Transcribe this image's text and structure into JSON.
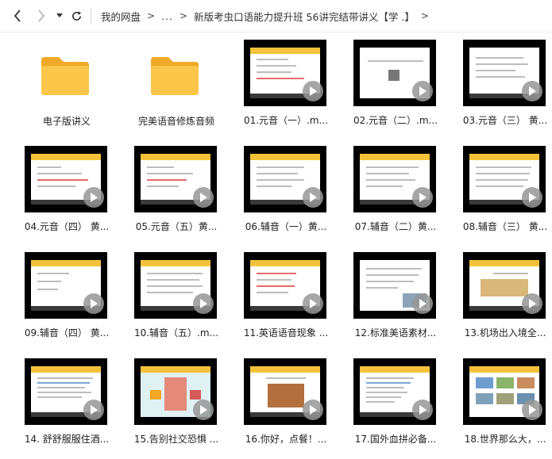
{
  "nav": {
    "back": "back-icon",
    "forward": "forward-icon",
    "dropdown": "caret-down-icon",
    "refresh": "refresh-icon"
  },
  "breadcrumb": {
    "root": "我的网盘",
    "ellipsis": "...",
    "current": "新版考虫口语能力提升班 56讲完结带讲义【学 .】"
  },
  "colors": {
    "folder": "#f6b93b",
    "thumb_bg": "#000000",
    "slide_band": "#f3c23a"
  },
  "items": [
    {
      "name": "电子版讲义",
      "type": "folder"
    },
    {
      "name": "完美语音修炼音频",
      "type": "folder"
    },
    {
      "name": "01.元音（一）.m...",
      "type": "video"
    },
    {
      "name": "02.元音（二）.m...",
      "type": "video"
    },
    {
      "name": "03.元音（三） 黄...",
      "type": "video"
    },
    {
      "name": "04.元音（四） 黄...",
      "type": "video"
    },
    {
      "name": "05.元音（五）黄...",
      "type": "video"
    },
    {
      "name": "06.辅音（一）黄...",
      "type": "video"
    },
    {
      "name": "07.辅音（二）黄...",
      "type": "video"
    },
    {
      "name": "08.辅音（三） 黄...",
      "type": "video"
    },
    {
      "name": "09.辅音（四） 黄...",
      "type": "video"
    },
    {
      "name": "10.辅音（五）.m...",
      "type": "video"
    },
    {
      "name": "11.英语语音现象 ...",
      "type": "video"
    },
    {
      "name": "12.标准美语素材...",
      "type": "video"
    },
    {
      "name": "13.机场出入境全...",
      "type": "video"
    },
    {
      "name": "14. 舒舒服服住酒...",
      "type": "video"
    },
    {
      "name": "15.告别社交恐惧 ...",
      "type": "video"
    },
    {
      "name": "16.你好，点餐！...",
      "type": "video"
    },
    {
      "name": "17.国外血拼必备...",
      "type": "video"
    },
    {
      "name": "18.世界那么大，...",
      "type": "video"
    }
  ]
}
